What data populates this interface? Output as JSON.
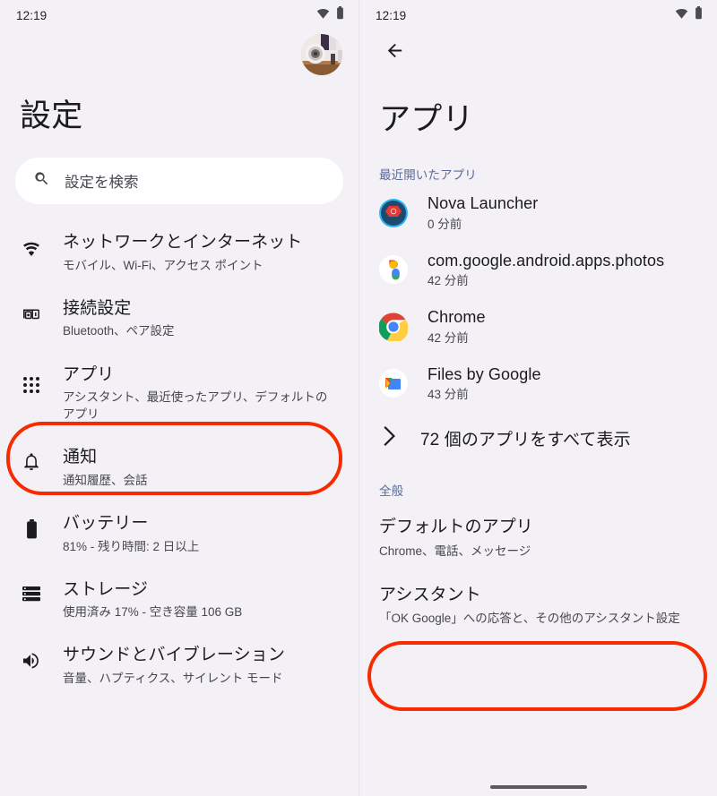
{
  "theme": {
    "background": "#f3f0f6",
    "surface": "#ffffff",
    "text_primary": "#1b1b1f",
    "text_secondary": "#47464f",
    "accent_section": "#5b6b9a",
    "highlight": "#f72a00"
  },
  "left_screen": {
    "status_bar": {
      "clock": "12:19",
      "wifi_icon": "wifi-icon",
      "battery_icon": "battery-icon"
    },
    "avatar": {
      "icon": "account-avatar"
    },
    "page_title": "設定",
    "search": {
      "placeholder": "設定を検索",
      "icon": "search-icon"
    },
    "items": [
      {
        "icon": "wifi-icon",
        "title": "ネットワークとインターネット",
        "subtitle": "モバイル、Wi-Fi、アクセス ポイント"
      },
      {
        "icon": "connected-devices-icon",
        "title": "接続設定",
        "subtitle": "Bluetooth、ペア設定"
      },
      {
        "icon": "apps-grid-icon",
        "title": "アプリ",
        "subtitle": "アシスタント、最近使ったアプリ、デフォルトのアプリ",
        "highlighted": true
      },
      {
        "icon": "bell-icon",
        "title": "通知",
        "subtitle": "通知履歴、会話"
      },
      {
        "icon": "battery-icon",
        "title": "バッテリー",
        "subtitle": "81% - 残り時間: 2 日以上"
      },
      {
        "icon": "storage-icon",
        "title": "ストレージ",
        "subtitle": "使用済み 17% - 空き容量 106 GB"
      },
      {
        "icon": "volume-icon",
        "title": "サウンドとバイブレーション",
        "subtitle": "音量、ハプティクス、サイレント モード"
      }
    ]
  },
  "right_screen": {
    "status_bar": {
      "clock": "12:19",
      "wifi_icon": "wifi-icon",
      "battery_icon": "battery-icon"
    },
    "back_icon": "back-arrow-icon",
    "page_title": "アプリ",
    "recent_section_label": "最近開いたアプリ",
    "recent_apps": [
      {
        "icon": "nova-launcher-icon",
        "name": "Nova Launcher",
        "time": "0 分前"
      },
      {
        "icon": "google-photos-icon",
        "name": "com.google.android.apps.photos",
        "time": "42 分前"
      },
      {
        "icon": "chrome-icon",
        "name": "Chrome",
        "time": "42 分前"
      },
      {
        "icon": "files-by-google-icon",
        "name": "Files by Google",
        "time": "43 分前"
      }
    ],
    "see_all": {
      "icon": "chevron-right-icon",
      "label": "72 個のアプリをすべて表示"
    },
    "general_section_label": "全般",
    "general_items": [
      {
        "title": "デフォルトのアプリ",
        "subtitle": "Chrome、電話、メッセージ",
        "highlighted": true
      },
      {
        "title": "アシスタント",
        "subtitle": "「OK Google」への応答と、その他のアシスタント設定"
      }
    ]
  }
}
